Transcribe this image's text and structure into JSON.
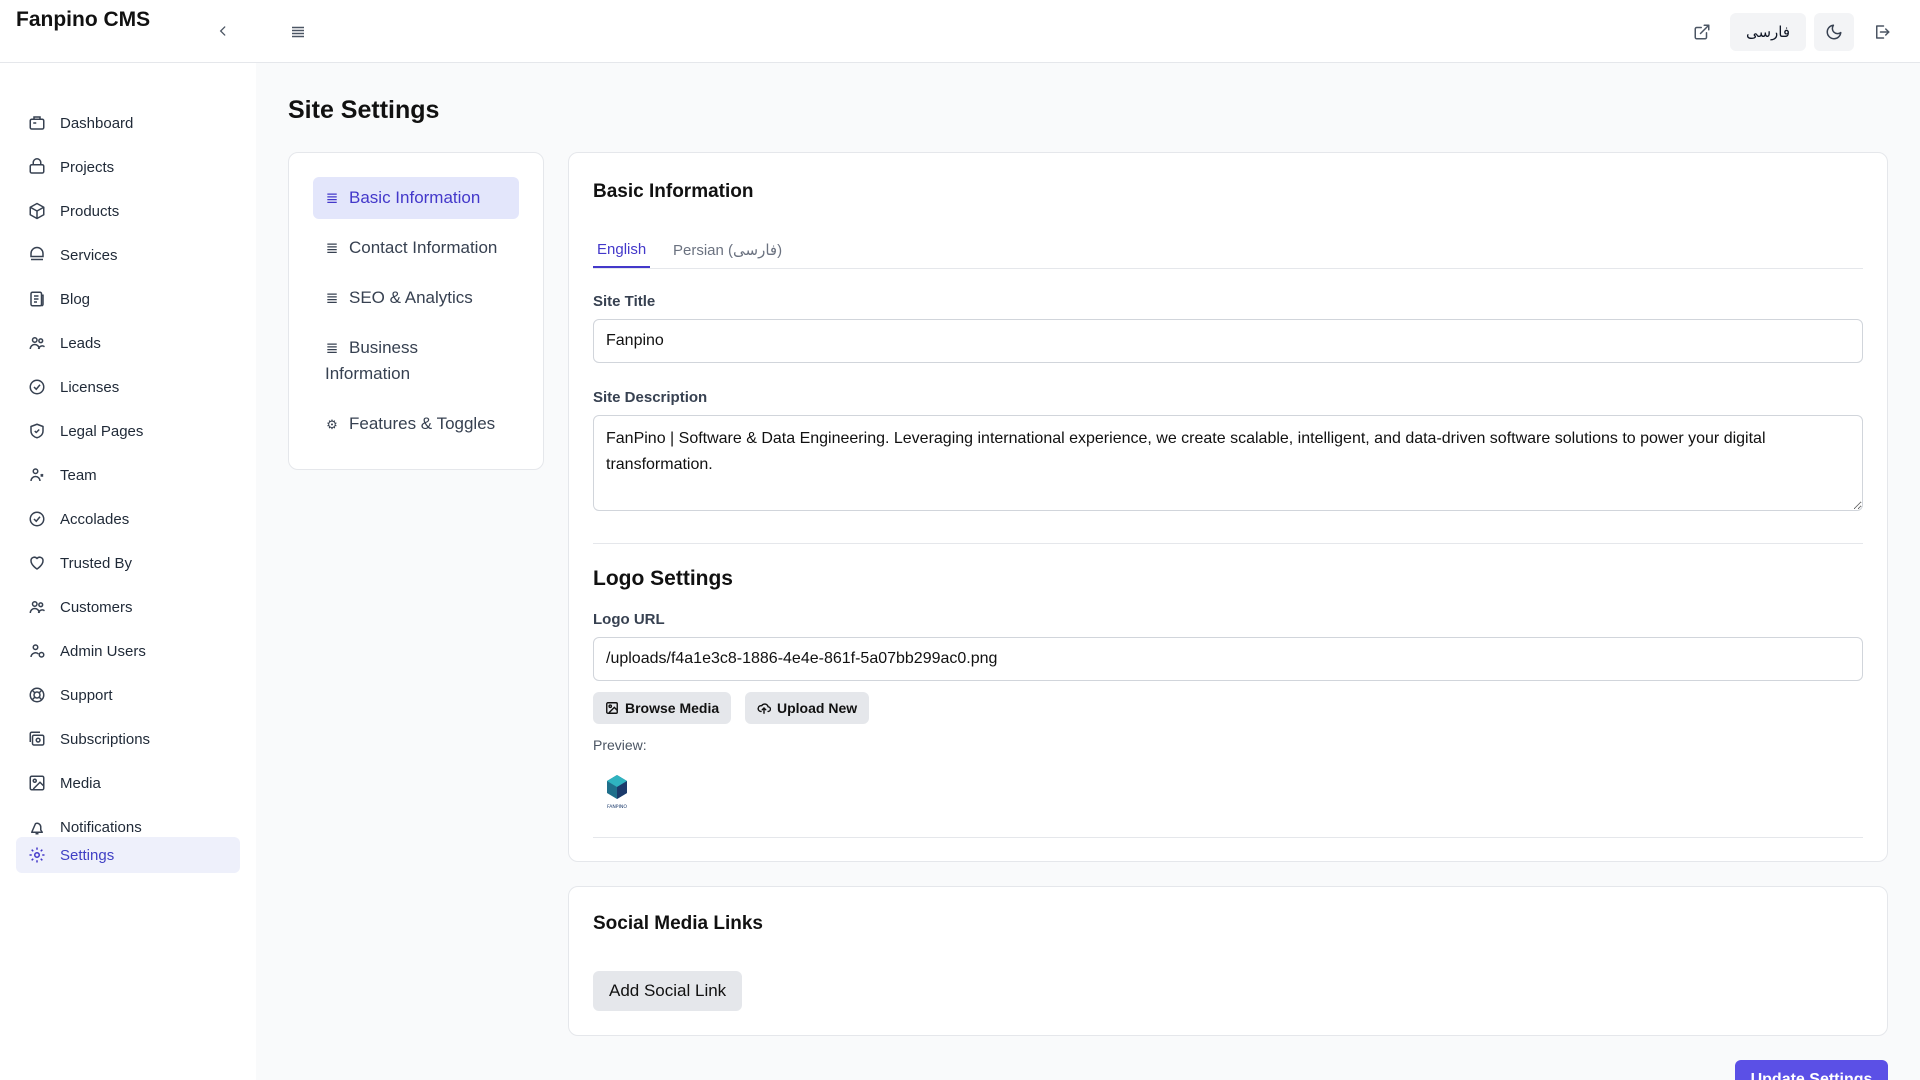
{
  "app": {
    "brand": "Fanpino CMS"
  },
  "topbar": {
    "language_button": "فارسی"
  },
  "sidebar": {
    "items": [
      {
        "label": "Dashboard",
        "icon": "dashboard-icon"
      },
      {
        "label": "Projects",
        "icon": "briefcase-icon"
      },
      {
        "label": "Products",
        "icon": "package-icon"
      },
      {
        "label": "Services",
        "icon": "services-icon"
      },
      {
        "label": "Blog",
        "icon": "blog-icon"
      },
      {
        "label": "Leads",
        "icon": "users-icon"
      },
      {
        "label": "Licenses",
        "icon": "check-circle-icon"
      },
      {
        "label": "Legal Pages",
        "icon": "shield-icon"
      },
      {
        "label": "Team",
        "icon": "team-icon"
      },
      {
        "label": "Accolades",
        "icon": "check-circle-icon"
      },
      {
        "label": "Trusted By",
        "icon": "heart-icon"
      },
      {
        "label": "Customers",
        "icon": "users-icon"
      },
      {
        "label": "Admin Users",
        "icon": "admin-user-icon"
      },
      {
        "label": "Support",
        "icon": "lifebuoy-icon"
      },
      {
        "label": "Subscriptions",
        "icon": "subscriptions-icon"
      },
      {
        "label": "Media",
        "icon": "image-icon"
      },
      {
        "label": "Notifications",
        "icon": "bell-icon"
      },
      {
        "label": "Settings",
        "icon": "gear-icon",
        "active": true
      }
    ]
  },
  "main": {
    "page_title": "Site Settings",
    "settings_tabs": [
      {
        "label": "Basic Information",
        "icon": "list-icon",
        "active": true
      },
      {
        "label": "Contact Information",
        "icon": "list-icon"
      },
      {
        "label": "SEO & Analytics",
        "icon": "list-icon"
      },
      {
        "label": "Business Information",
        "icon": "list-icon"
      },
      {
        "label": "Features & Toggles",
        "icon": "gear-icon"
      }
    ],
    "basic_info": {
      "heading": "Basic Information",
      "lang_tabs": [
        "English",
        "Persian (فارسی)"
      ],
      "active_lang": "English",
      "site_title_label": "Site Title",
      "site_title_value": "Fanpino",
      "site_description_label": "Site Description",
      "site_description_value": "FanPino | Software & Data Engineering. Leveraging international experience, we create scalable, intelligent, and data-driven software solutions to power your digital transformation.",
      "logo_heading": "Logo Settings",
      "logo_url_label": "Logo URL",
      "logo_url_value": "/uploads/f4a1e3c8-1886-4e4e-861f-5a07bb299ac0.png",
      "browse_media": "Browse Media",
      "upload_new": "Upload New",
      "preview_label": "Preview:",
      "logo_text": "FANPINO"
    },
    "social": {
      "heading": "Social Media Links",
      "add_button": "Add Social Link"
    },
    "update_button": "Update Settings"
  },
  "colors": {
    "accent": "#4338ca",
    "active_bg": "#e3e6fb",
    "primary_button": "#5b50e6"
  }
}
